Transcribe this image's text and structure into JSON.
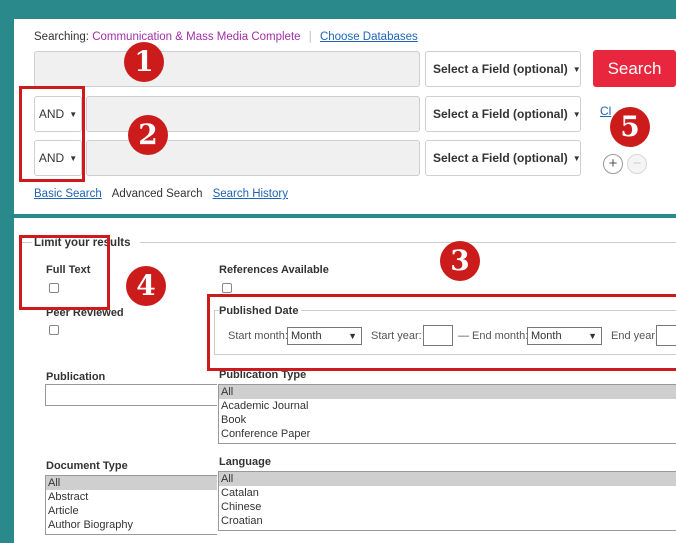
{
  "search": {
    "searching_label": "Searching:",
    "database": "Communication & Mass Media Complete",
    "choose_databases": "Choose Databases",
    "field_select": "Select a Field (optional)",
    "bool_op": "AND",
    "search_button": "Search",
    "clear_link": "Cl",
    "add_row": "+",
    "remove_row": "−"
  },
  "modes": {
    "basic": "Basic Search",
    "advanced": "Advanced Search",
    "history": "Search History"
  },
  "markers": [
    "1",
    "2",
    "3",
    "4",
    "5"
  ],
  "limits": {
    "legend": "Limit your results",
    "full_text": "Full Text",
    "peer_reviewed": "Peer Reviewed",
    "references": "References Available",
    "published_date": "Published Date",
    "start_month_label": "Start month:",
    "month_value": "Month",
    "start_year_label": "Start year:",
    "dash": "—",
    "end_month_label": "End month:",
    "end_year_label": "End year:",
    "publication": "Publication",
    "publication_type": "Publication Type",
    "publication_type_options": [
      "All",
      "Academic Journal",
      "Book",
      "Conference Paper"
    ],
    "document_type": "Document Type",
    "document_type_options": [
      "All",
      "Abstract",
      "Article",
      "Author Biography"
    ],
    "language": "Language",
    "language_options": [
      "All",
      "Catalan",
      "Chinese",
      "Croatian"
    ]
  },
  "colors": {
    "accent_red": "#e8263d",
    "annotation_red": "#cc1b1b",
    "database_purple": "#a12fa8",
    "link_blue": "#1f64b5",
    "frame_teal": "#2a8a8b"
  }
}
